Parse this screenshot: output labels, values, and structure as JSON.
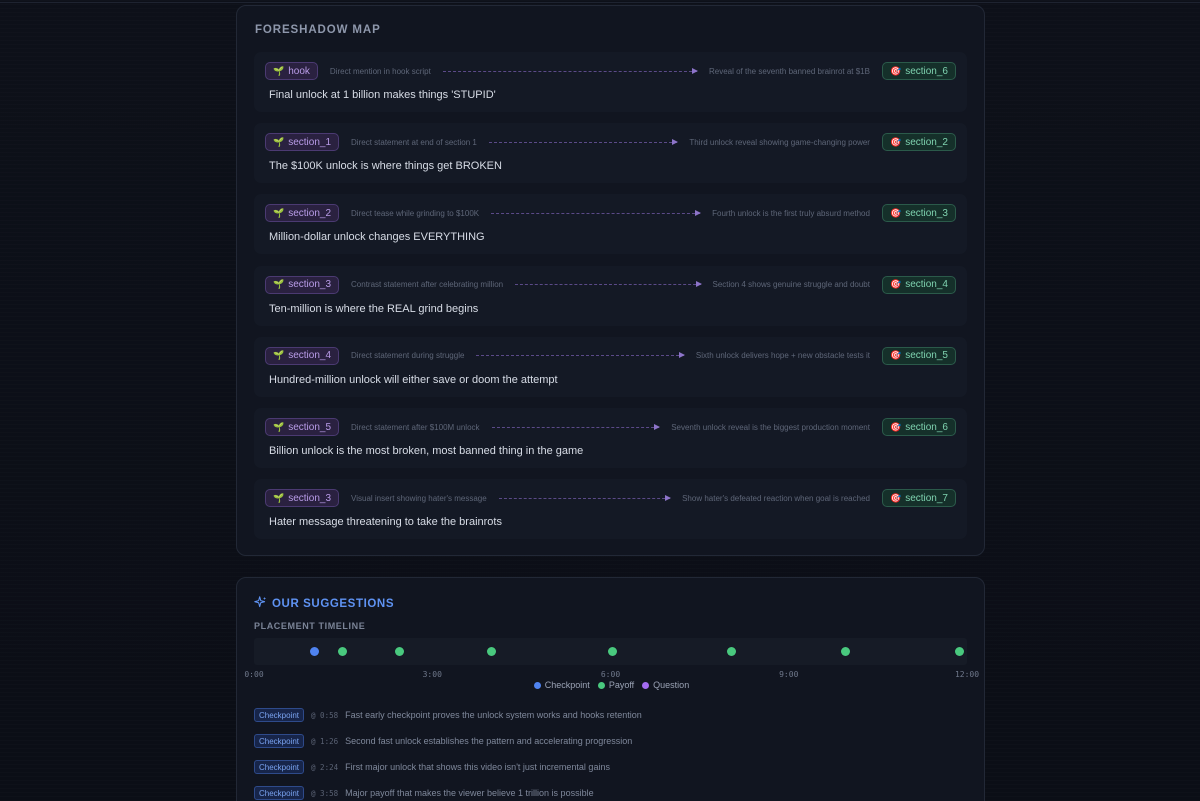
{
  "foreshadow": {
    "title": "FORESHADOW MAP",
    "source_icon": "seedling-icon",
    "target_icon": "target-icon",
    "rows": [
      {
        "source": "hook",
        "setup_note": "Direct mention in hook script",
        "payoff_note": "Reveal of the seventh banned brainrot at $1B",
        "target": "section_6",
        "text": "Final unlock at 1 billion makes things 'STUPID'"
      },
      {
        "source": "section_1",
        "setup_note": "Direct statement at end of section 1",
        "payoff_note": "Third unlock reveal showing game-changing power",
        "target": "section_2",
        "text": "The $100K unlock is where things get BROKEN"
      },
      {
        "source": "section_2",
        "setup_note": "Direct tease while grinding to $100K",
        "payoff_note": "Fourth unlock is the first truly absurd method",
        "target": "section_3",
        "text": "Million-dollar unlock changes EVERYTHING"
      },
      {
        "source": "section_3",
        "setup_note": "Contrast statement after celebrating million",
        "payoff_note": "Section 4 shows genuine struggle and doubt",
        "target": "section_4",
        "text": "Ten-million is where the REAL grind begins"
      },
      {
        "source": "section_4",
        "setup_note": "Direct statement during struggle",
        "payoff_note": "Sixth unlock delivers hope + new obstacle tests it",
        "target": "section_5",
        "text": "Hundred-million unlock will either save or doom the attempt"
      },
      {
        "source": "section_5",
        "setup_note": "Direct statement after $100M unlock",
        "payoff_note": "Seventh unlock reveal is the biggest production moment",
        "target": "section_6",
        "text": "Billion unlock is the most broken, most banned thing in the game"
      },
      {
        "source": "section_3",
        "setup_note": "Visual insert showing hater's message",
        "payoff_note": "Show hater's defeated reaction when goal is reached",
        "target": "section_7",
        "text": "Hater message threatening to take the brainrots"
      }
    ]
  },
  "suggestions": {
    "title": "OUR SUGGESTIONS",
    "icon": "sparkle-icon",
    "timeline_title": "PLACEMENT TIMELINE",
    "ticks": [
      "0:00",
      "3:00",
      "6:00",
      "9:00",
      "12:00"
    ],
    "legend": [
      {
        "label": "Checkpoint",
        "color": "#4f83f0"
      },
      {
        "label": "Payoff",
        "color": "#49c97e"
      },
      {
        "label": "Question",
        "color": "#a36bf0"
      }
    ],
    "markers": [
      {
        "time_sec": 58,
        "kind": "Checkpoint"
      },
      {
        "time_sec": 86,
        "kind": "Payoff"
      },
      {
        "time_sec": 144,
        "kind": "Payoff"
      },
      {
        "time_sec": 238,
        "kind": "Payoff"
      },
      {
        "time_sec": 362,
        "kind": "Payoff"
      },
      {
        "time_sec": 484,
        "kind": "Payoff"
      },
      {
        "time_sec": 600,
        "kind": "Payoff"
      },
      {
        "time_sec": 716,
        "kind": "Payoff"
      }
    ],
    "items": [
      {
        "tag": "Checkpoint",
        "time": "@ 0:58",
        "text": "Fast early checkpoint proves the unlock system works and hooks retention"
      },
      {
        "tag": "Checkpoint",
        "time": "@ 1:26",
        "text": "Second fast unlock establishes the pattern and accelerating progression"
      },
      {
        "tag": "Checkpoint",
        "time": "@ 2:24",
        "text": "First major unlock that shows this video isn't just incremental gains"
      },
      {
        "tag": "Checkpoint",
        "time": "@ 3:58",
        "text": "Major payoff that makes the viewer believe 1 trillion is possible"
      }
    ]
  }
}
